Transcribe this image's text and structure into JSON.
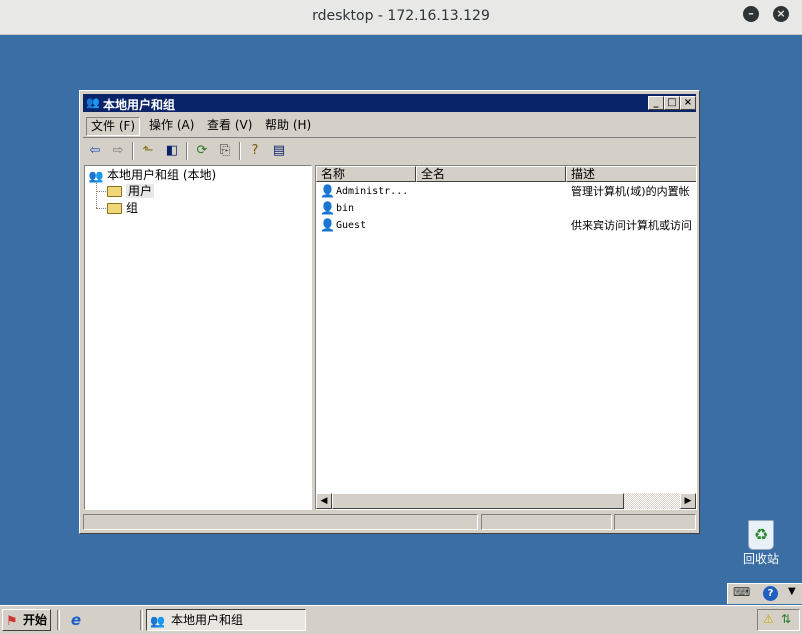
{
  "outer_window": {
    "title": "rdesktop - 172.16.13.129",
    "minimize_glyph": "⊖",
    "close_glyph": "⊗"
  },
  "mmc_window": {
    "title": "本地用户和组",
    "title_icon": "users-group-icon",
    "menu": [
      {
        "label": "文件 (F)"
      },
      {
        "label": "操作 (A)"
      },
      {
        "label": "查看 (V)"
      },
      {
        "label": "帮助 (H)"
      }
    ],
    "toolbar_icons": [
      "back-arrow-icon",
      "forward-arrow-icon",
      "up-folder-icon",
      "show-hide-tree-icon",
      "refresh-icon",
      "export-list-icon",
      "help-icon",
      "properties-icon"
    ],
    "tree": {
      "root_label": "本地用户和组 (本地)",
      "children": [
        {
          "label": "用户",
          "selected": true
        },
        {
          "label": "组",
          "selected": false
        }
      ]
    },
    "list": {
      "columns": [
        "名称",
        "全名",
        "描述"
      ],
      "rows": [
        {
          "name": "Administr...",
          "full_name": "",
          "description": "管理计算机(域)的内置帐",
          "disabled": false
        },
        {
          "name": "bin",
          "full_name": "",
          "description": "",
          "disabled": false
        },
        {
          "name": "Guest",
          "full_name": "",
          "description": "供来宾访问计算机或访问",
          "disabled": true
        }
      ]
    }
  },
  "desktop": {
    "recycle_bin_label": "回收站"
  },
  "taskbar": {
    "start_label": "开始",
    "task_label": "本地用户和组"
  },
  "colors": {
    "desktop": "#3a6ea5",
    "titlebar": "#0a246a",
    "face": "#d4d0c8"
  }
}
